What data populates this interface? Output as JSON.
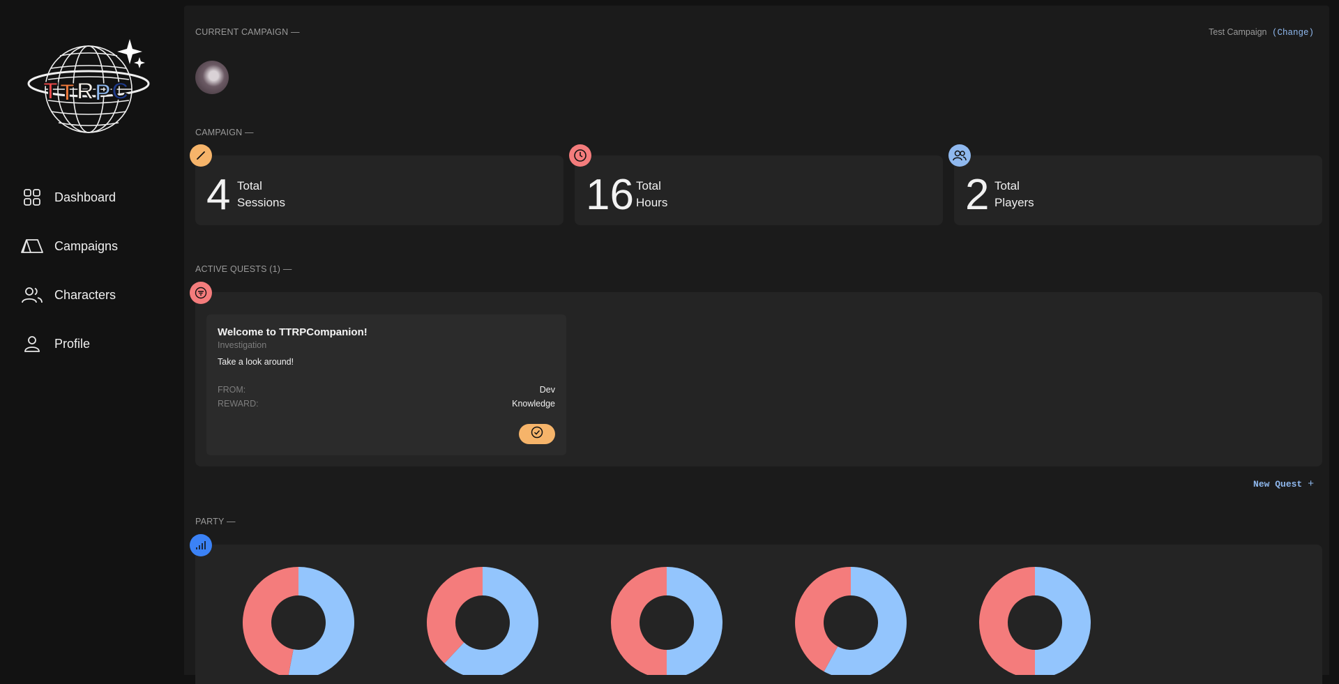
{
  "sidebar": {
    "logo_text": "TTRPC",
    "items": [
      {
        "label": "Dashboard",
        "icon": "grid-icon"
      },
      {
        "label": "Campaigns",
        "icon": "tent-icon"
      },
      {
        "label": "Characters",
        "icon": "users-icon"
      },
      {
        "label": "Profile",
        "icon": "user-icon"
      }
    ]
  },
  "current_campaign": {
    "label": "CURRENT CAMPAIGN —",
    "name": "Test Campaign",
    "change_label": "(Change)"
  },
  "campaign": {
    "label": "CAMPAIGN —",
    "stats": [
      {
        "value": "4",
        "line1": "Total",
        "line2": "Sessions",
        "icon": "pencil-icon",
        "color": "#f6b46a"
      },
      {
        "value": "16",
        "line1": "Total",
        "line2": "Hours",
        "icon": "clock-icon",
        "color": "#f47c7c"
      },
      {
        "value": "2",
        "line1": "Total",
        "line2": "Players",
        "icon": "users-icon",
        "color": "#8fb8ee"
      }
    ]
  },
  "quests": {
    "label": "ACTIVE QUESTS (1) —",
    "badge_color": "#f47c7c",
    "items": [
      {
        "title": "Welcome to TTRPCompanion!",
        "type": "Investigation",
        "description": "Take a look around!",
        "from_label": "FROM:",
        "from": "Dev",
        "reward_label": "REWARD:",
        "reward": "Knowledge"
      }
    ],
    "new_quest_label": "New Quest"
  },
  "party": {
    "label": "PARTY —",
    "badge_color": "#3b82f6",
    "chart_colors": {
      "a": "#f47c7c",
      "b": "#93c5fd"
    }
  },
  "chart_data": {
    "type": "pie",
    "series_count": 5,
    "series": [
      {
        "values": [
          47,
          53
        ]
      },
      {
        "values": [
          38,
          62
        ]
      },
      {
        "values": [
          50,
          50
        ]
      },
      {
        "values": [
          42,
          58
        ]
      },
      {
        "values": [
          50,
          50
        ]
      }
    ]
  }
}
